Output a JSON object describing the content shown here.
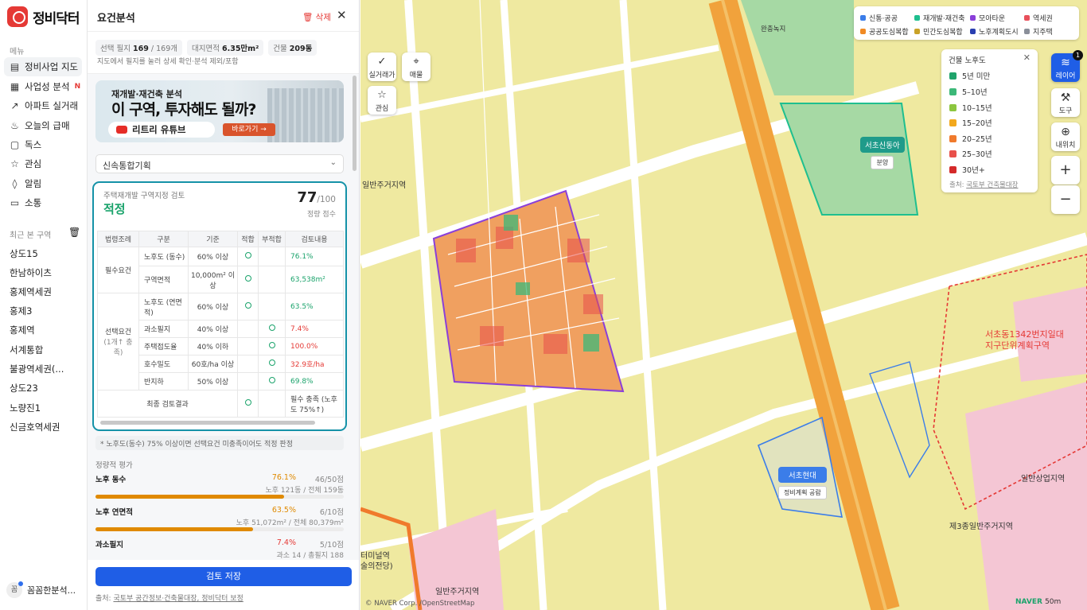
{
  "app": {
    "logo_text": "정비닥터"
  },
  "nav": {
    "section_menu": "메뉴",
    "items": [
      {
        "label": "정비사업 지도",
        "icon": "map-icon"
      },
      {
        "label": "사업성 분석",
        "icon": "document-icon",
        "new": "N"
      },
      {
        "label": "아파트 실거래",
        "icon": "trend-icon"
      },
      {
        "label": "오늘의 급매",
        "icon": "fire-icon"
      },
      {
        "label": "독스",
        "icon": "doc-icon"
      },
      {
        "label": "관심",
        "icon": "star-icon"
      },
      {
        "label": "알림",
        "icon": "bell-icon"
      },
      {
        "label": "소통",
        "icon": "chat-icon"
      }
    ],
    "section_recent": "최근 본 구역",
    "recent": [
      "상도15",
      "한남하이츠",
      "홍제역세권",
      "홍제3",
      "홍제역",
      "서계통합",
      "불광역세권(...",
      "상도23",
      "노량진1",
      "신금호역세권"
    ],
    "profile": {
      "avatar": "꼼",
      "name": "꼼꼼한분석..."
    }
  },
  "panel": {
    "title": "요건분석",
    "delete": "삭제",
    "stats": {
      "sel_label": "선택 필지",
      "sel_value": "169",
      "sel_total": "/ 169개",
      "area_label": "대지면적",
      "area_value": "6.35만m²",
      "bld_label": "건물",
      "bld_value": "209동"
    },
    "hint": "지도에서 필지를 눌러 상세 확인·분석 제외/포함",
    "banner": {
      "line1": "재개발·재건축 분석",
      "line2": "이 구역, 투자해도 될까?",
      "yt": "리트리 유튜브",
      "go": "바로가기 →"
    },
    "select_value": "신속통합기획",
    "card": {
      "caption": "주택재개발 구역지정 검토",
      "result": "적정",
      "score": "77",
      "score_max": "/100",
      "score_label": "정량 점수",
      "headers": [
        "법령조례",
        "구분",
        "기준",
        "적합",
        "부적합",
        "검토내용"
      ],
      "group1": "필수요건",
      "group2": "선택요건",
      "group2_sub": "(1개↑ 충족)",
      "rows": [
        {
          "name": "노후도 (동수)",
          "crit": "60% 이상",
          "ok": true,
          "val": "76.1%"
        },
        {
          "name": "구역면적",
          "crit": "10,000m² 이상",
          "ok": true,
          "val": "63,538m²"
        },
        {
          "name": "노후도 (연면적)",
          "crit": "60% 이상",
          "ok": true,
          "val": "63.5%"
        },
        {
          "name": "과소필지",
          "crit": "40% 이상",
          "ok": false,
          "val": "7.4%"
        },
        {
          "name": "주택접도율",
          "crit": "40% 이하",
          "ok": false,
          "val": "100.0%"
        },
        {
          "name": "호수밀도",
          "crit": "60호/ha 이상",
          "ok": false,
          "val": "32.9호/ha"
        },
        {
          "name": "반지하",
          "crit": "50% 이상",
          "ok": true,
          "val": "69.8%"
        }
      ],
      "final_label": "최종 검토결과",
      "final_value": "필수 충족 (노후도 75%↑)"
    },
    "note": "* 노후도(동수) 75% 이상이면 선택요건 미충족이어도 적정 판정",
    "quant_title": "정량적 평가",
    "quant": [
      {
        "name": "노후 동수",
        "pct": "76.1%",
        "pts": "46/50점",
        "detail": "노후 121동 / 전체 159동",
        "fill": 0.761
      },
      {
        "name": "노후 연면적",
        "pct": "63.5%",
        "pts": "6/10점",
        "detail": "노후 51,072m² / 전체 80,379m²",
        "fill": 0.635
      },
      {
        "name": "과소필지",
        "pct": "7.4%",
        "pts": "5/10점",
        "detail": "과소 14 / 총필지 188",
        "fill": 0.074
      }
    ],
    "save": "검토 저장",
    "source_prefix": "출처:",
    "source": "국토부 공간정보·건축물대장, 정비닥터 보정"
  },
  "map": {
    "tools_left": [
      "실거래가",
      "매물",
      "관심"
    ],
    "legend_top": [
      {
        "label": "신통·공공",
        "color": "#3b7de9"
      },
      {
        "label": "재개발·재건축",
        "color": "#1fbf8f"
      },
      {
        "label": "모아타운",
        "color": "#8a3fd9"
      },
      {
        "label": "역세권",
        "color": "#e8505b"
      },
      {
        "label": "공공도심복합",
        "color": "#f08a24"
      },
      {
        "label": "민간도심복합",
        "color": "#c9a227"
      },
      {
        "label": "노후계획도시",
        "color": "#2a3fb0"
      },
      {
        "label": "지주택",
        "color": "#8a8f99"
      }
    ],
    "age_title": "건물 노후도",
    "age": [
      {
        "label": "5년 미만",
        "color": "#1fa36b"
      },
      {
        "label": "5–10년",
        "color": "#3cb878"
      },
      {
        "label": "10–15년",
        "color": "#8cc63f"
      },
      {
        "label": "15–20년",
        "color": "#f2a81d"
      },
      {
        "label": "20–25년",
        "color": "#f07a2c"
      },
      {
        "label": "25–30년",
        "color": "#e8504b"
      },
      {
        "label": "30년+",
        "color": "#d42a2a"
      }
    ],
    "age_source_prefix": "출처:",
    "age_source": "국토부 건축물대장",
    "tools_right": [
      "레이어",
      "도구",
      "내위치"
    ],
    "layer_badge": "1",
    "zoom_in": "+",
    "zoom_out": "−",
    "tag1": {
      "name": "서초신동아",
      "sub": "분양"
    },
    "tag2": {
      "name": "서초현대",
      "sub": "정비계획 공람"
    },
    "labels": [
      "완충녹지",
      "일반주거지역",
      "서초동1342번지일대",
      "지구단위계획구역",
      "일반상업지역",
      "제3종일반주거지역",
      "일반주거지역",
      "터미널역",
      "술의전당)"
    ],
    "copyright": "© NAVER Corp. /OpenStreetMap",
    "naver": "NAVER",
    "scale": "50m"
  }
}
